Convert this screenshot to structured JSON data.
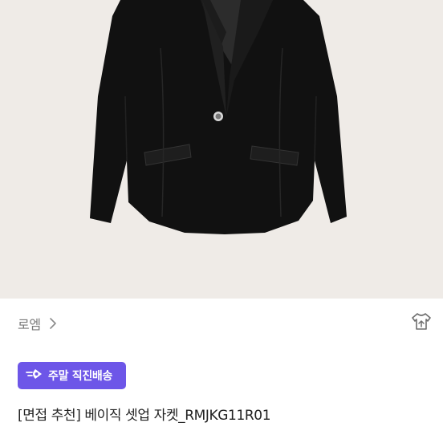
{
  "product": {
    "brand": "로엠",
    "shipping_badge": "주말 직진배송",
    "title": "[면접 추천] 베이직 셋업 자켓_RMJKG11R01"
  },
  "icons": {
    "brand_chevron": "chevron-right-icon",
    "share": "share-icon",
    "badge": "fast-delivery-icon"
  },
  "colors": {
    "badge_bg": "#6d56e8",
    "image_bg": "#efebe7"
  }
}
